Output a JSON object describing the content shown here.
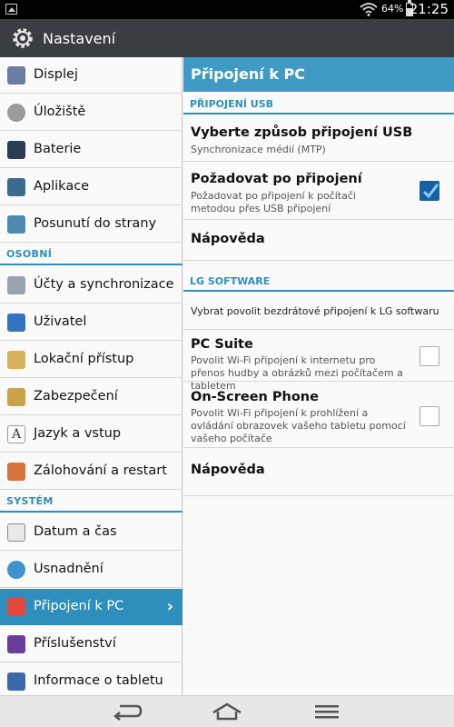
{
  "status": {
    "battery_percent": "64%",
    "battery_level": 0.64,
    "time": "21:25"
  },
  "app": {
    "title": "Nastavení",
    "icons": {
      "settings": "gear-icon"
    }
  },
  "left": {
    "items_top": [
      {
        "label": "Displej",
        "icon": "display-icon"
      },
      {
        "label": "Úložiště",
        "icon": "storage-icon"
      },
      {
        "label": "Baterie",
        "icon": "battery-icon"
      },
      {
        "label": "Aplikace",
        "icon": "apps-icon"
      },
      {
        "label": "Posunutí do strany",
        "icon": "side-swipe-icon"
      }
    ],
    "section_personal": "OSOBNÍ",
    "items_personal": [
      {
        "label": "Účty a synchronizace",
        "icon": "accounts-icon"
      },
      {
        "label": "Uživatel",
        "icon": "user-icon"
      },
      {
        "label": "Lokační přístup",
        "icon": "location-icon"
      },
      {
        "label": "Zabezpečení",
        "icon": "lock-icon"
      },
      {
        "label": "Jazyk a vstup",
        "icon": "language-icon"
      },
      {
        "label": "Zálohování a restart",
        "icon": "backup-icon"
      }
    ],
    "section_system": "SYSTÉM",
    "items_system": [
      {
        "label": "Datum a čas",
        "icon": "calendar-icon"
      },
      {
        "label": "Usnadnění",
        "icon": "accessibility-icon"
      },
      {
        "label": "Připojení k PC",
        "icon": "pc-connection-icon",
        "active": true
      },
      {
        "label": "Příslušenství",
        "icon": "accessories-icon"
      },
      {
        "label": "Informace o tabletu",
        "icon": "info-icon"
      }
    ]
  },
  "right": {
    "title": "Připojení k PC",
    "section_usb": "PŘIPOJENÍ USB",
    "usb_method_title": "Vyberte způsob připojení USB",
    "usb_method_summary": "Synchronizace médií (MTP)",
    "ask_title": "Požadovat po připojení",
    "ask_summary": "Požadovat po připojení k počítači metodou přes USB připojení",
    "ask_checked": true,
    "help1": "Nápověda",
    "section_lg": "LG SOFTWARE",
    "lg_desc": "Vybrat povolit bezdrátové připojení k LG softwaru",
    "pcsuite_title": "PC Suite",
    "pcsuite_summary": "Povolit Wi-Fi připojení k internetu pro přenos hudby a obrázků mezi počítačem a tabletem",
    "pcsuite_checked": false,
    "osp_title": "On-Screen Phone",
    "osp_summary": "Povolit Wi-Fi připojení k prohlížení a ovládání obrazovek vašeho tabletu pomocí vašeho počítače",
    "osp_checked": false,
    "help2": "Nápověda"
  },
  "nav": {
    "back": "back-icon",
    "home": "home-icon",
    "menu": "menu-icon"
  },
  "colors": {
    "accent": "#2e8fbc",
    "header": "#3a3d41"
  }
}
